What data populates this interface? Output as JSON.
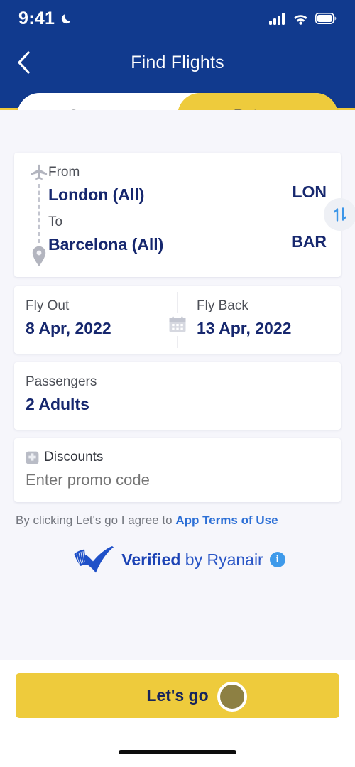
{
  "status_bar": {
    "time": "9:41",
    "dnd_icon": "crescent-moon-icon",
    "signal_icon": "cellular-signal-icon",
    "wifi_icon": "wifi-icon",
    "battery_icon": "battery-full-icon"
  },
  "header": {
    "title": "Find Flights",
    "back_icon": "chevron-left-icon",
    "background_color": "#113a8e",
    "accent_color": "#efc93b"
  },
  "trip_type": {
    "options": [
      {
        "label": "One way",
        "active": false
      },
      {
        "label": "Return",
        "active": true
      }
    ]
  },
  "route": {
    "origin_icon": "airplane-icon",
    "destination_icon": "map-pin-icon",
    "from": {
      "label": "From",
      "value": "London (All)",
      "code": "LON"
    },
    "to": {
      "label": "To",
      "value": "Barcelona (All)",
      "code": "BAR"
    },
    "swap_icon": "swap-vertical-icon"
  },
  "dates": {
    "calendar_icon": "calendar-icon",
    "out": {
      "label": "Fly Out",
      "value": "8 Apr, 2022"
    },
    "back": {
      "label": "Fly Back",
      "value": "13 Apr, 2022"
    }
  },
  "passengers": {
    "label": "Passengers",
    "value": "2 Adults"
  },
  "discounts": {
    "label": "Discounts",
    "icon": "discount-tag-icon",
    "placeholder": "Enter promo code",
    "value": ""
  },
  "terms": {
    "prefix": "By clicking Let's go I agree to ",
    "link_label": "App Terms of Use"
  },
  "verified": {
    "logo_icon": "ryanair-harp-logo-icon",
    "bold_text": "Verified",
    "rest_text": " by Ryanair",
    "info_icon": "info-circle-icon"
  },
  "cta": {
    "label": "Let's go",
    "background_color": "#eecb3c",
    "text_color": "#17255c"
  },
  "home_indicator": "home-indicator"
}
